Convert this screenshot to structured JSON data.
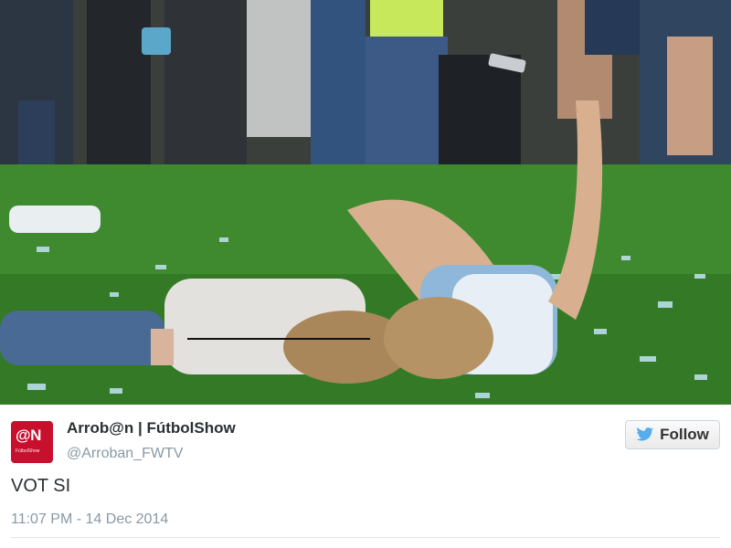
{
  "tweet": {
    "display_name": "Arrob@n | FútbolShow",
    "handle": "@Arroban_FWTV",
    "text": "VOT SI",
    "timestamp": "11:07 PM - 14 Dec 2014",
    "follow_label": "Follow",
    "avatar": {
      "logo_text": "@N",
      "subtitle": "FútbolShow"
    }
  },
  "colors": {
    "twitter_blue": "#55acee",
    "avatar_red": "#c8102e",
    "name_color": "#292f33",
    "muted": "#8899a6"
  },
  "icons": [
    "twitter-bird-icon"
  ]
}
